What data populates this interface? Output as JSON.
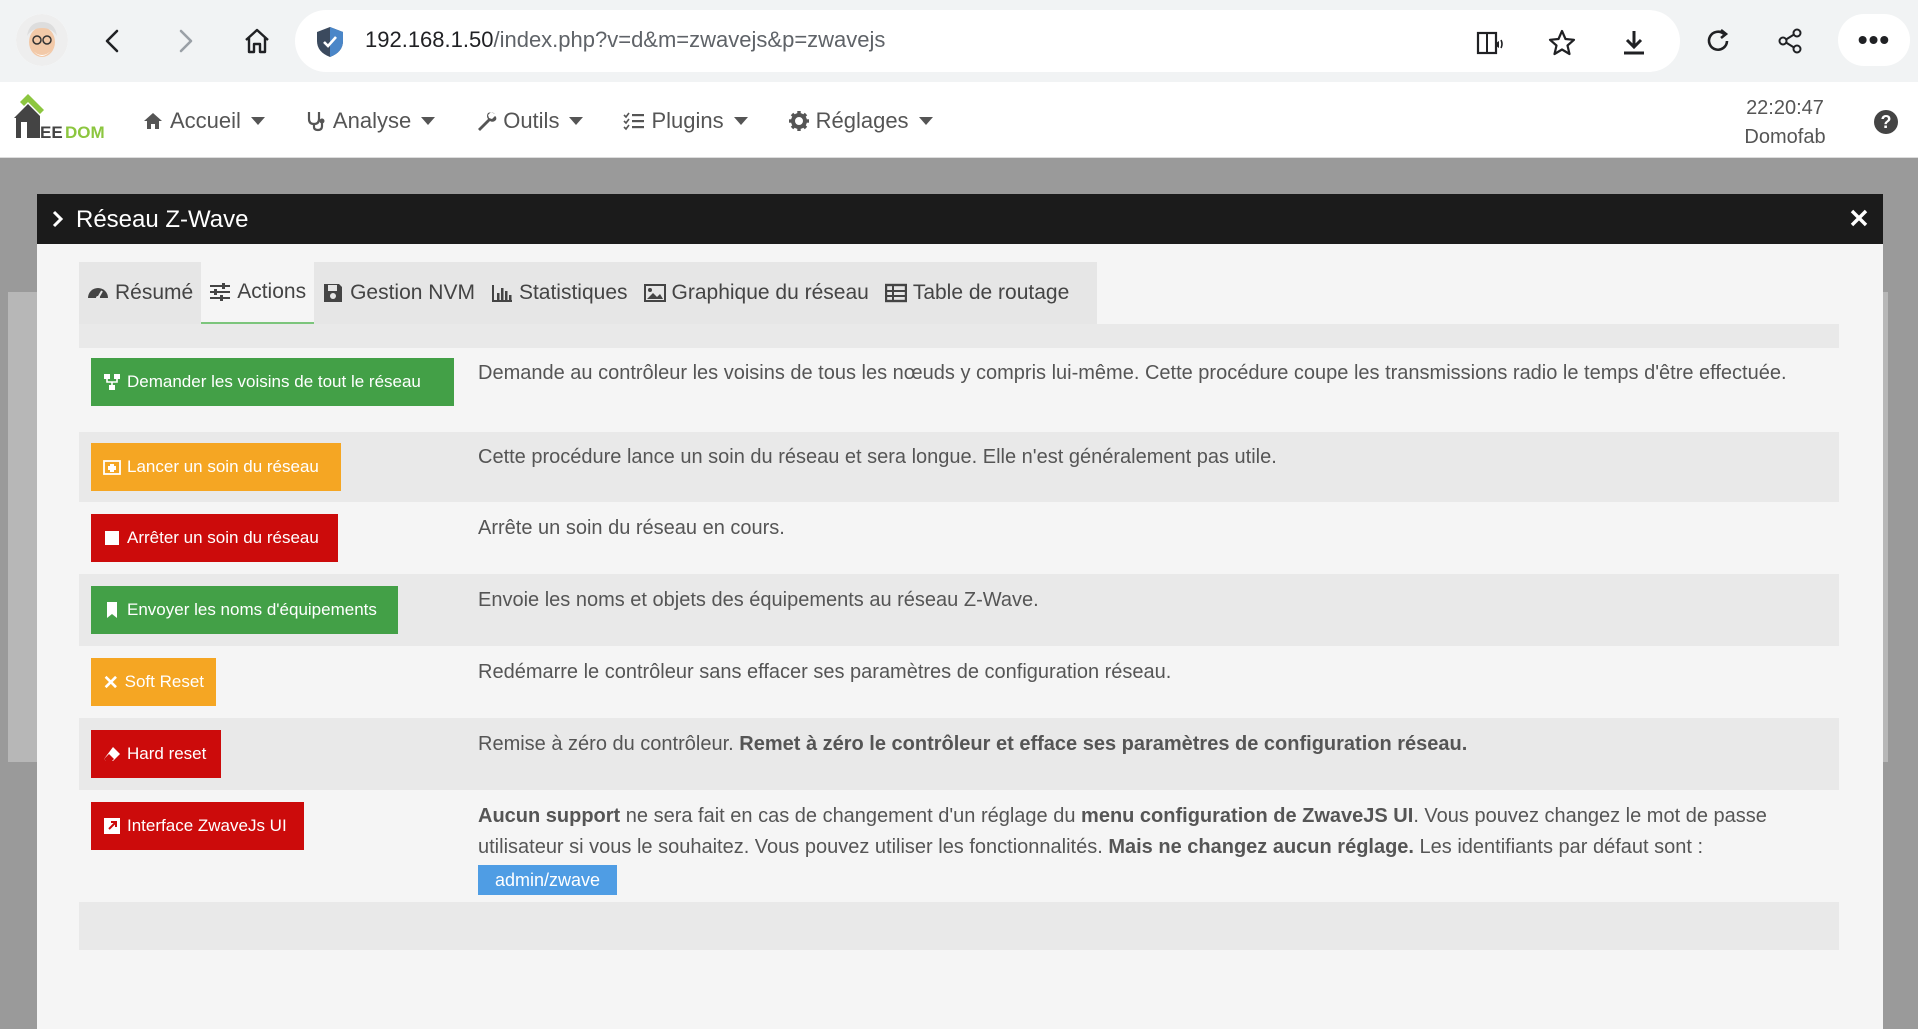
{
  "browser": {
    "url_host": "192.168.1.50",
    "url_path": "/index.php?v=d&m=zwavejs&p=zwavejs",
    "more_label": "•••"
  },
  "navbar": {
    "menu": [
      {
        "label": "Accueil",
        "icon": "home-icon"
      },
      {
        "label": "Analyse",
        "icon": "stethoscope-icon"
      },
      {
        "label": "Outils",
        "icon": "wrench-icon"
      },
      {
        "label": "Plugins",
        "icon": "list-icon"
      },
      {
        "label": "Réglages",
        "icon": "gear-icon"
      }
    ],
    "time": "22:20:47",
    "user": "Domofab"
  },
  "modal": {
    "title": "Réseau Z-Wave",
    "tabs": [
      {
        "label": "Résumé",
        "icon": "dashboard-icon"
      },
      {
        "label": "Actions",
        "icon": "sliders-icon",
        "active": true
      },
      {
        "label": "Gestion NVM",
        "icon": "save-icon"
      },
      {
        "label": "Statistiques",
        "icon": "bar-chart-icon"
      },
      {
        "label": "Graphique du réseau",
        "icon": "image-icon"
      },
      {
        "label": "Table de routage",
        "icon": "table-icon"
      }
    ],
    "actions": [
      {
        "label": "Demander les voisins de tout le réseau",
        "color": "#43a047",
        "desc": "Demande au contrôleur les voisins de tous les nœuds y compris lui-même. Cette procédure coupe les transmissions radio le temps d'être effectuée."
      },
      {
        "label": "Lancer un soin du réseau",
        "color": "#f5a623",
        "desc": "Cette procédure lance un soin du réseau et sera longue. Elle n'est généralement pas utile."
      },
      {
        "label": "Arrêter un soin du réseau",
        "color": "#cc0b0b",
        "desc": "Arrête un soin du réseau en cours."
      },
      {
        "label": "Envoyer les noms d'équipements",
        "color": "#43a047",
        "desc": "Envoie les noms et objets des équipements au réseau Z-Wave."
      },
      {
        "label": "Soft Reset",
        "color": "#f5a623",
        "desc": "Redémarre le contrôleur sans effacer ses paramètres de configuration réseau."
      },
      {
        "label": "Hard reset",
        "color": "#cc0b0b",
        "desc_plain": "Remise à zéro du contrôleur. ",
        "desc_bold": "Remet à zéro le contrôleur et efface ses paramètres de configuration réseau."
      },
      {
        "label": "Interface ZwaveJs UI",
        "color": "#cc0b0b",
        "desc_parts": [
          "Aucun support",
          " ne sera fait en cas de changement d'un réglage du ",
          "menu configuration de ZwaveJS UI",
          ". Vous pouvez changez le mot de passe utilisateur si vous le souhaitez. Vous pouvez utiliser les fonctionnalités. ",
          "Mais ne changez aucun réglage.",
          " Les identifiants par défaut sont :"
        ],
        "credentials": "admin/zwave"
      }
    ]
  }
}
